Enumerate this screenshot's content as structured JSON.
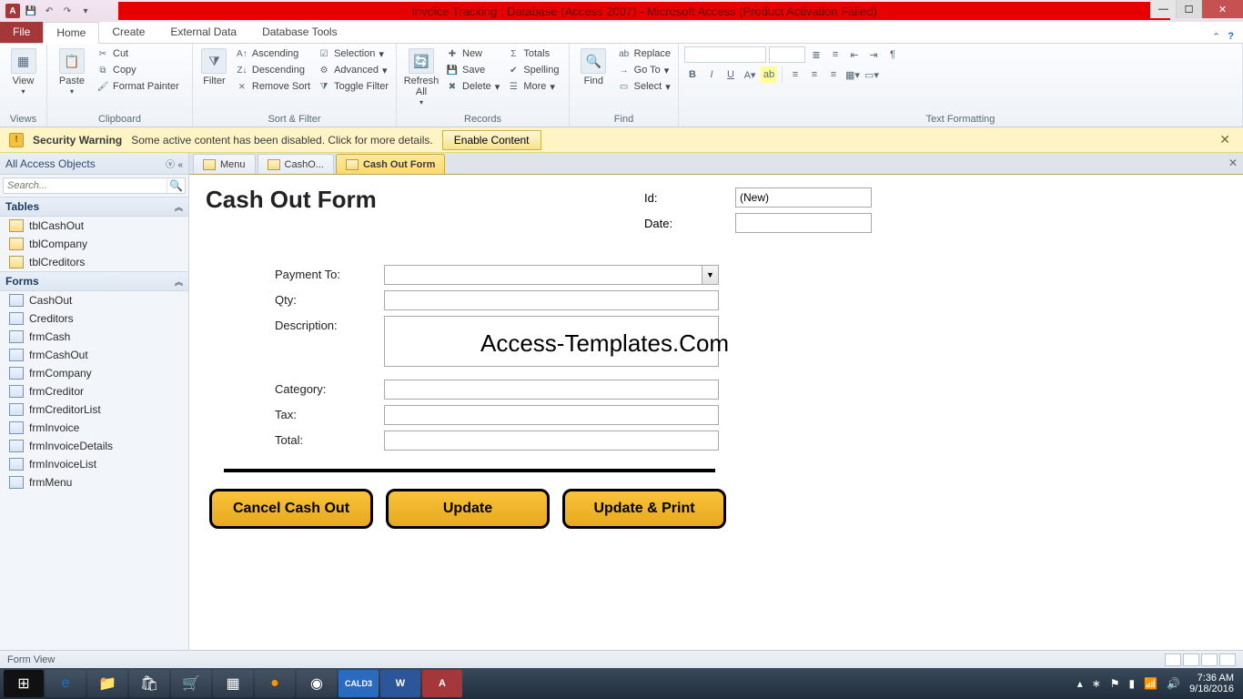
{
  "title": "Invoice Tracking : Database (Access 2007) - Microsoft Access (Product Activation Failed)",
  "ribbon_tabs": {
    "file": "File",
    "home": "Home",
    "create": "Create",
    "external": "External Data",
    "dbtools": "Database Tools"
  },
  "groups": {
    "views": "Views",
    "clipboard": "Clipboard",
    "sortfilter": "Sort & Filter",
    "records": "Records",
    "find": "Find",
    "textfmt": "Text Formatting"
  },
  "btn": {
    "view": "View",
    "paste": "Paste",
    "cut": "Cut",
    "copy": "Copy",
    "format_painter": "Format Painter",
    "filter": "Filter",
    "asc": "Ascending",
    "desc": "Descending",
    "remove_sort": "Remove Sort",
    "selection": "Selection",
    "advanced": "Advanced",
    "toggle_filter": "Toggle Filter",
    "refresh_all": "Refresh\nAll",
    "new": "New",
    "save": "Save",
    "delete": "Delete",
    "totals": "Totals",
    "spelling": "Spelling",
    "more": "More",
    "find_btn": "Find",
    "replace": "Replace",
    "goto": "Go To",
    "select": "Select"
  },
  "security": {
    "label": "Security Warning",
    "msg": "Some active content has been disabled. Click for more details.",
    "enable": "Enable Content"
  },
  "nav": {
    "title": "All Access Objects",
    "search_placeholder": "Search...",
    "tables_hdr": "Tables",
    "forms_hdr": "Forms",
    "tables": [
      "tblCashOut",
      "tblCompany",
      "tblCreditors"
    ],
    "forms": [
      "CashOut",
      "Creditors",
      "frmCash",
      "frmCashOut",
      "frmCompany",
      "frmCreditor",
      "frmCreditorList",
      "frmInvoice",
      "frmInvoiceDetails",
      "frmInvoiceList",
      "frmMenu"
    ]
  },
  "doc_tabs": {
    "t0": "Menu",
    "t1": "CashO...",
    "t2": "Cash Out Form"
  },
  "form": {
    "title": "Cash Out Form",
    "id_label": "Id:",
    "id_value": "(New)",
    "date_label": "Date:",
    "date_value": "",
    "payment_to": "Payment To:",
    "qty": "Qty:",
    "description": "Description:",
    "category": "Category:",
    "tax": "Tax:",
    "total": "Total:",
    "btn_cancel": "Cancel Cash Out",
    "btn_update": "Update",
    "btn_update_print": "Update & Print"
  },
  "watermark": "Access-Templates.Com",
  "status": "Form View",
  "tray": {
    "time": "7:36 AM",
    "date": "9/18/2016"
  }
}
